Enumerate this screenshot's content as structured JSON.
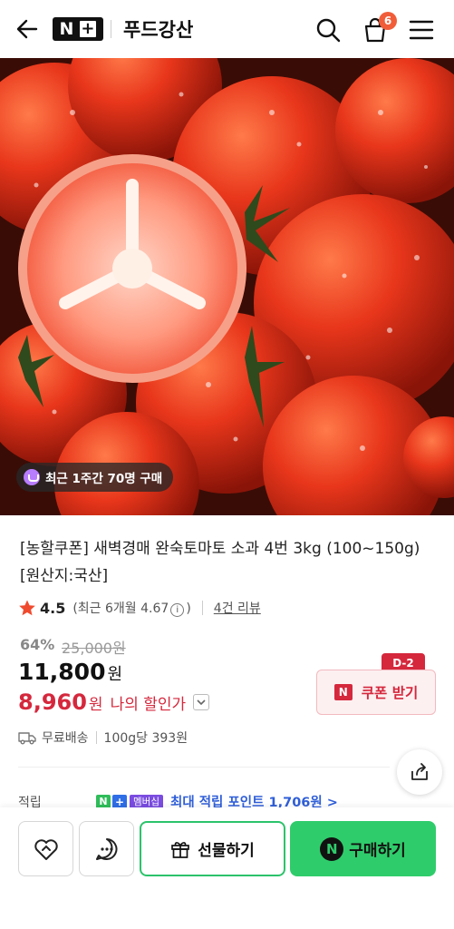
{
  "header": {
    "logo_text": "N",
    "logo_plus": "+",
    "title": "푸드강산",
    "cart_count": "6"
  },
  "hero": {
    "social_proof": "최근 1주간 70명 구매"
  },
  "product": {
    "title": "[농할쿠폰] 새벽경매 완숙토마토 소과 4번 3kg (100~150g) [원산지:국산]",
    "rating": "4.5",
    "rating_detail_prefix": "(최근 6개월 4.67",
    "rating_detail_suffix": ")",
    "info_icon_glyph": "i",
    "review_count": "4건 리뷰",
    "discount_rate": "64%",
    "original_price": "25,000원",
    "price": "11,800",
    "price_unit": "원",
    "my_price": "8,960",
    "my_price_unit": "원",
    "my_price_label": "나의 할인가",
    "coupon_dday": "D-2",
    "coupon_n": "N",
    "coupon_label": "쿠폰 받기",
    "shipping": "무료배송",
    "unit_price": "100g당 393원",
    "points_label": "적립",
    "points_badge_n": "N",
    "points_badge_plus": "+",
    "points_badge_membership": "멤버십",
    "points_text": "최대 적립 포인트 1,706원 >"
  },
  "bottom": {
    "gift_label": "선물하기",
    "buy_label": "구매하기",
    "buy_icon": "N"
  },
  "colors": {
    "accent_green": "#2fcc6b",
    "price_red": "#d5283d",
    "badge_orange": "#f05d38",
    "points_blue": "#2f5ed8"
  },
  "icons": [
    "back-arrow-icon",
    "search-icon",
    "cart-icon",
    "menu-icon",
    "star-icon",
    "truck-icon",
    "share-icon",
    "heart-icon",
    "chat-icon",
    "gift-icon"
  ]
}
